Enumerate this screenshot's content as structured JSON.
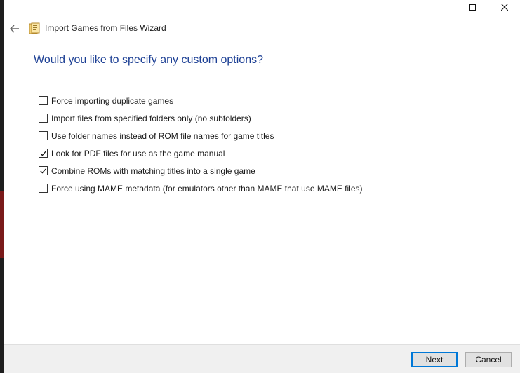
{
  "window": {
    "title": "Import Games from Files Wizard",
    "caption_buttons": [
      "minimize",
      "maximize",
      "close"
    ]
  },
  "header": {
    "back_icon": "arrow-left-icon",
    "wizard_icon": "folder-icon"
  },
  "page": {
    "question": "Would you like to specify any custom options?"
  },
  "options": [
    {
      "label": "Force importing duplicate games",
      "checked": false
    },
    {
      "label": "Import files from specified folders only (no subfolders)",
      "checked": false
    },
    {
      "label": "Use folder names instead of ROM file names for game titles",
      "checked": false
    },
    {
      "label": "Look for PDF files for use as the game manual",
      "checked": true
    },
    {
      "label": "Combine ROMs with matching titles into a single game",
      "checked": true
    },
    {
      "label": "Force using MAME metadata (for emulators other than MAME that use MAME files)",
      "checked": false
    }
  ],
  "footer": {
    "next_label": "Next",
    "cancel_label": "Cancel"
  },
  "colors": {
    "heading": "#1c3f94",
    "default_button_border": "#0078d7"
  }
}
